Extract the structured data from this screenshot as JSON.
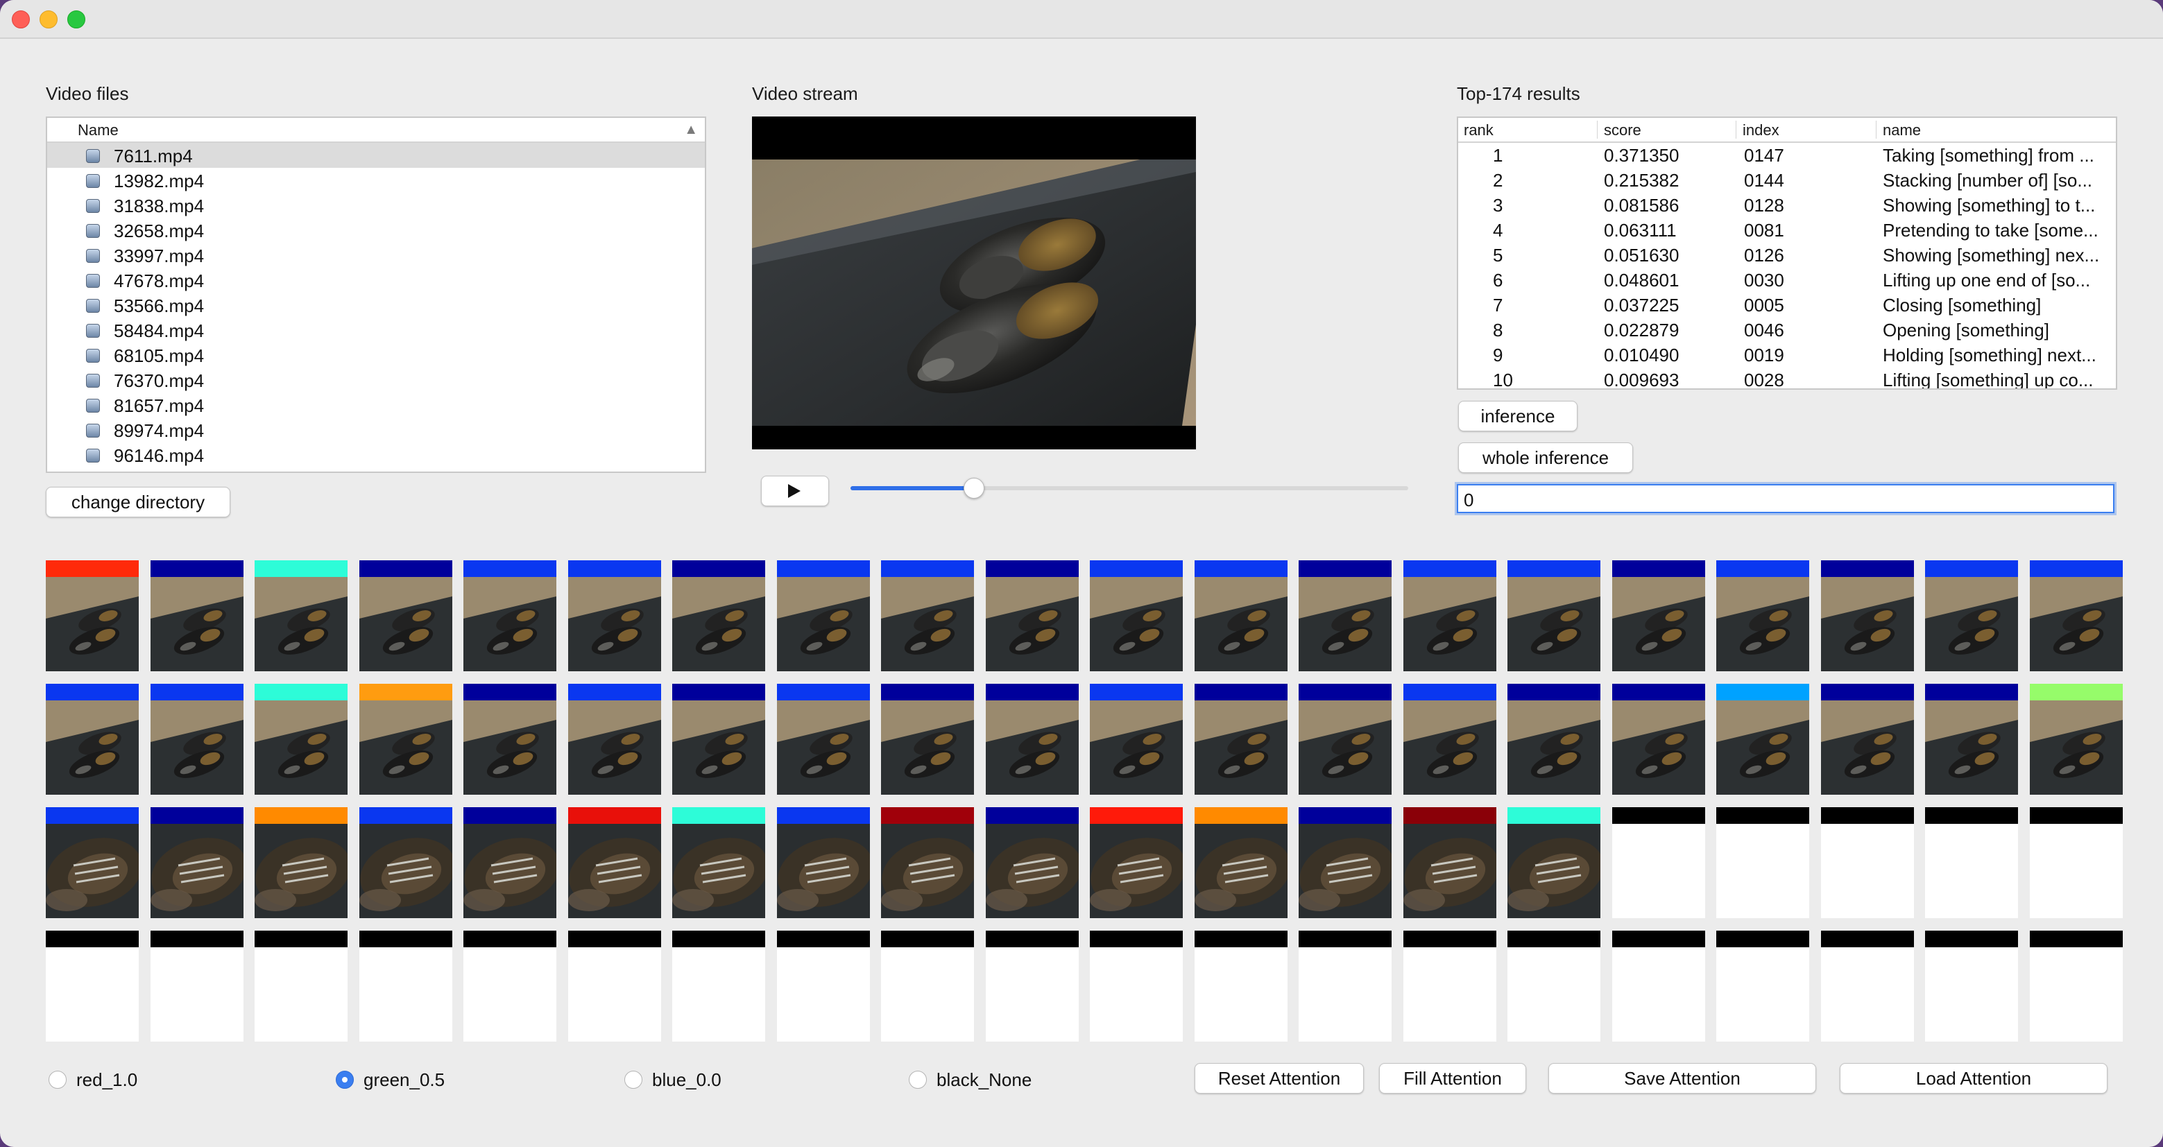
{
  "window": {
    "controls": [
      "close",
      "minimize",
      "zoom"
    ]
  },
  "video_files": {
    "title": "Video files",
    "column_header": "Name",
    "sort_indicator": "▲",
    "files": [
      "7611.mp4",
      "13982.mp4",
      "31838.mp4",
      "32658.mp4",
      "33997.mp4",
      "47678.mp4",
      "53566.mp4",
      "58484.mp4",
      "68105.mp4",
      "76370.mp4",
      "81657.mp4",
      "89974.mp4",
      "96146.mp4"
    ],
    "selected": "7611.mp4",
    "change_directory_label": "change directory"
  },
  "video_stream": {
    "title": "Video stream",
    "play_icon": "play-icon",
    "progress_fraction": 0.22
  },
  "results": {
    "title": "Top-174 results",
    "columns": [
      "rank",
      "score",
      "index",
      "name"
    ],
    "rows": [
      {
        "rank": "1",
        "score": "0.371350",
        "index": "0147",
        "name": "Taking [something] from ..."
      },
      {
        "rank": "2",
        "score": "0.215382",
        "index": "0144",
        "name": "Stacking [number of] [so..."
      },
      {
        "rank": "3",
        "score": "0.081586",
        "index": "0128",
        "name": "Showing [something] to t..."
      },
      {
        "rank": "4",
        "score": "0.063111",
        "index": "0081",
        "name": "Pretending to take [some..."
      },
      {
        "rank": "5",
        "score": "0.051630",
        "index": "0126",
        "name": "Showing [something] nex..."
      },
      {
        "rank": "6",
        "score": "0.048601",
        "index": "0030",
        "name": "Lifting up one end of [so..."
      },
      {
        "rank": "7",
        "score": "0.037225",
        "index": "0005",
        "name": "Closing [something]"
      },
      {
        "rank": "8",
        "score": "0.022879",
        "index": "0046",
        "name": "Opening [something]"
      },
      {
        "rank": "9",
        "score": "0.010490",
        "index": "0019",
        "name": "Holding [something] next..."
      },
      {
        "rank": "10",
        "score": "0.009693",
        "index": "0028",
        "name": "Lifting [something] up co..."
      }
    ],
    "inference_label": "inference",
    "whole_inference_label": "whole inference",
    "input_value": "0"
  },
  "frames": {
    "attention_colors": [
      "#ff2a0a",
      "#00009b",
      "#2dfcd8",
      "#00009b",
      "#0a37f0",
      "#0a37f0",
      "#00009b",
      "#0a37f0",
      "#0a37f0",
      "#00009b",
      "#0a37f0",
      "#0a37f0",
      "#00009b",
      "#0a37f0",
      "#0a37f0",
      "#00009b",
      "#0a37f0",
      "#00009b",
      "#0a37f0",
      "#0a37f0",
      "#0a37f0",
      "#0a37f0",
      "#2dfcd8",
      "#ff9c10",
      "#00009b",
      "#0a37f0",
      "#00009b",
      "#0a37f0",
      "#00009b",
      "#00009b",
      "#0a37f0",
      "#00009b",
      "#00009b",
      "#0a37f0",
      "#00009b",
      "#00009b",
      "#00a2ff",
      "#00009b",
      "#00009b",
      "#96fc6a",
      "#0a37f0",
      "#00009b",
      "#ff8a00",
      "#0a37f0",
      "#00009b",
      "#e8100a",
      "#2dfcd8",
      "#0a37f0",
      "#a0000a",
      "#00009b",
      "#ff1a0a",
      "#ff8a00",
      "#00009b",
      "#8a0008",
      "#2dfcd8",
      "#000000",
      "#000000",
      "#000000",
      "#000000",
      "#000000",
      "#000000",
      "#000000",
      "#000000",
      "#000000",
      "#000000",
      "#000000",
      "#000000",
      "#000000",
      "#000000",
      "#000000",
      "#000000",
      "#000000",
      "#000000",
      "#000000",
      "#000000",
      "#000000",
      "#000000",
      "#000000",
      "#000000",
      "#000000"
    ],
    "frames_with_image": 55,
    "closeup_start": 40
  },
  "attention_options": [
    {
      "label": "red_1.0",
      "selected": false
    },
    {
      "label": "green_0.5",
      "selected": true
    },
    {
      "label": "blue_0.0",
      "selected": false
    },
    {
      "label": "black_None",
      "selected": false
    }
  ],
  "attention_buttons": {
    "reset": "Reset Attention",
    "fill": "Fill Attention",
    "save": "Save Attention",
    "load": "Load Attention"
  }
}
